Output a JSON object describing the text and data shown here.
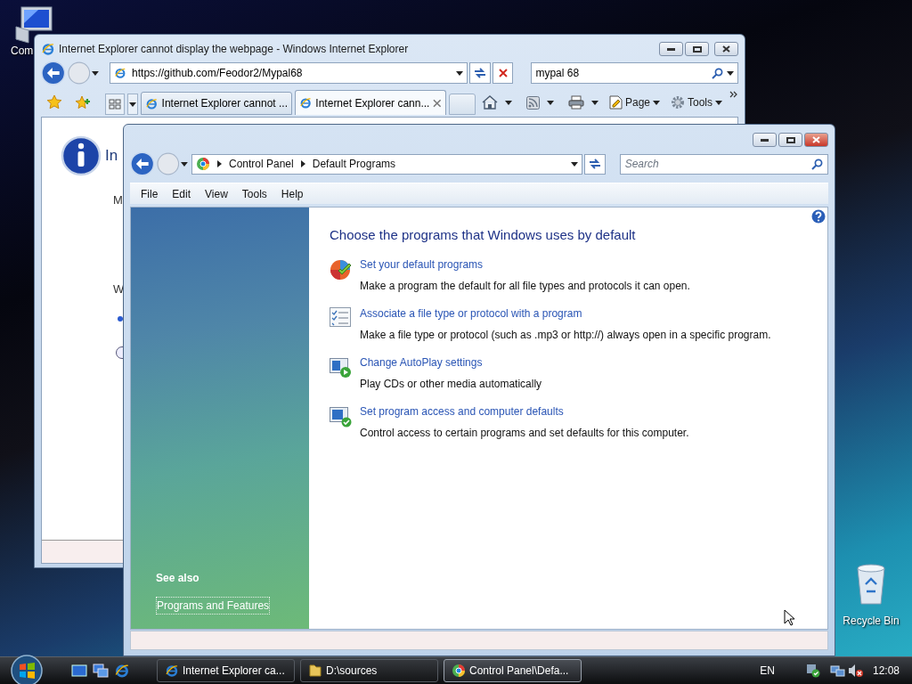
{
  "desktop_icons": [
    {
      "label": "Com"
    },
    {
      "label": "Recycle Bin"
    }
  ],
  "browser": {
    "title": "Internet Explorer cannot display the webpage - Windows Internet Explorer",
    "address": "https://github.com/Feodor2/Mypal68",
    "search": "mypal 68",
    "tabs": [
      {
        "label": "Internet Explorer cannot ...",
        "selected": false
      },
      {
        "label": "Internet Explorer cann...",
        "selected": true
      }
    ],
    "commands": [
      "Page",
      "Tools"
    ],
    "content": {
      "heading": "In",
      "line_1": "M",
      "line_2": "W"
    }
  },
  "explorer": {
    "breadcrumb": [
      "Control Panel",
      "Default Programs"
    ],
    "search": {
      "placeholder": "Search"
    },
    "menu": [
      "File",
      "Edit",
      "View",
      "Tools",
      "Help"
    ],
    "heading": "Choose the programs that Windows uses by default",
    "tasks": [
      {
        "title": "Set your default programs",
        "description": "Make a program the default for all file types and protocols it can open."
      },
      {
        "title": "Associate a file type or protocol with a program",
        "description": "Make a file type or protocol (such as .mp3 or http://) always open in a specific program."
      },
      {
        "title": "Change AutoPlay settings",
        "description": "Play CDs or other media automatically"
      },
      {
        "title": "Set program access and computer defaults",
        "description": "Control access to certain programs and set defaults for this computer."
      }
    ],
    "see_also": {
      "heading": "See also",
      "links": [
        "Programs and Features"
      ]
    }
  },
  "taskbar": {
    "buttons": [
      {
        "label": "Internet Explorer ca...",
        "selected": false
      },
      {
        "label": "D:\\sources",
        "selected": false
      },
      {
        "label": "Control Panel\\Defa...",
        "selected": true
      }
    ],
    "language": "EN",
    "clock": "12:08"
  }
}
